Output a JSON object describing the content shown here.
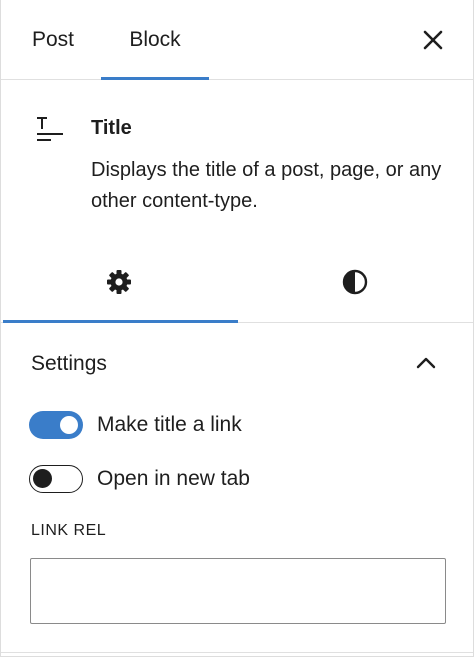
{
  "header": {
    "tabs": [
      {
        "label": "Post",
        "active": false
      },
      {
        "label": "Block",
        "active": true
      }
    ],
    "close_icon": "close-icon"
  },
  "block_card": {
    "icon": "title-block-icon",
    "title": "Title",
    "description": "Displays the title of a post, page, or any other content-type."
  },
  "sub_tabs": [
    {
      "icon": "gear-icon",
      "active": true
    },
    {
      "icon": "contrast-icon",
      "active": false
    }
  ],
  "settings": {
    "title": "Settings",
    "collapse_icon": "chevron-up-icon",
    "toggles": [
      {
        "label": "Make title a link",
        "checked": true
      },
      {
        "label": "Open in new tab",
        "checked": false
      }
    ],
    "link_rel": {
      "label": "LINK REL",
      "value": ""
    }
  },
  "colors": {
    "accent": "#3a7dc9",
    "text": "#1e1e1e",
    "border": "#e0e0e0"
  }
}
